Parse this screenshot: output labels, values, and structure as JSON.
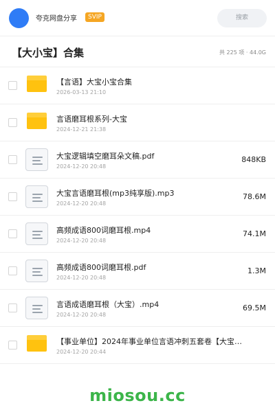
{
  "topbar": {
    "app_name": "夸克网盘分享",
    "badge": "SVIP",
    "search_label": "搜索"
  },
  "header": {
    "title": "【大小宝】合集",
    "stats": "共 225 项 · 44.0G"
  },
  "files": [
    {
      "type": "folder",
      "icon": "folder-icon",
      "name": "【言语】大宝小宝合集",
      "date": "2026-03-13 21:10",
      "size": ""
    },
    {
      "type": "folder",
      "icon": "folder-icon",
      "name": "言语磨耳根系列-大宝",
      "date": "2024-12-21 21:38",
      "size": ""
    },
    {
      "type": "file",
      "icon": "document-icon",
      "name": "大宝逻辑填空磨耳朵文稿.pdf",
      "date": "2024-12-20 20:48",
      "size": "848KB"
    },
    {
      "type": "file",
      "icon": "document-icon",
      "name": "大宝言语磨耳根(mp3纯享版).mp3",
      "date": "2024-12-20 20:48",
      "size": "78.6M"
    },
    {
      "type": "file",
      "icon": "document-icon",
      "name": "高频成语800词磨耳根.mp4",
      "date": "2024-12-20 20:48",
      "size": "74.1M"
    },
    {
      "type": "file",
      "icon": "document-icon",
      "name": "高频成语800词磨耳根.pdf",
      "date": "2024-12-20 20:48",
      "size": "1.3M"
    },
    {
      "type": "file",
      "icon": "document-icon",
      "name": "言语成语磨耳根（大宝）.mp4",
      "date": "2024-12-20 20:48",
      "size": "69.5M"
    },
    {
      "type": "folder",
      "icon": "folder-icon",
      "name": "【事业单位】2024年事业单位言语冲刺五套卷【大宝…",
      "date": "2024-12-20 20:44",
      "size": ""
    }
  ],
  "watermark": "miosou.cc",
  "colors": {
    "accent": "#2f7cf6",
    "badge": "#f5a623",
    "folder": "#ffc20f",
    "watermark": "#3cb54a"
  }
}
